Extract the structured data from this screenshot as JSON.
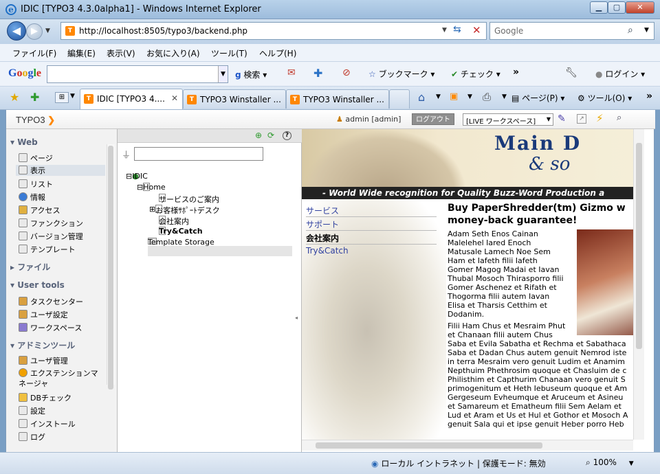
{
  "window": {
    "title": "IDIC [TYPO3 4.3.0alpha1] - Windows Internet Explorer"
  },
  "address": {
    "url": "http://localhost:8505/typo3/backend.php"
  },
  "search": {
    "placeholder": "Google"
  },
  "menu": [
    "ファイル(F)",
    "編集(E)",
    "表示(V)",
    "お気に入り(A)",
    "ツール(T)",
    "ヘルプ(H)"
  ],
  "google_toolbar": {
    "logo": "Google",
    "search": "検索",
    "bookmarks": "ブックマーク",
    "check": "チェック",
    "login": "ログイン"
  },
  "tabs": [
    {
      "label": "IDIC [TYPO3 4....",
      "active": true
    },
    {
      "label": "TYPO3 Winstaller ...",
      "active": false
    },
    {
      "label": "TYPO3 Winstaller ...",
      "active": false
    }
  ],
  "cmdbar": {
    "page": "ページ(P)",
    "tools": "ツール(O)"
  },
  "typo3": {
    "logo": "TYPO3",
    "user": "admin [admin]",
    "logout": "ログアウト",
    "workspace": "[LIVE ワークスペース]"
  },
  "modules": {
    "web": {
      "title": "Web",
      "items": [
        "ページ",
        "表示",
        "リスト",
        "情報",
        "アクセス",
        "ファンクション",
        "バージョン管理",
        "テンプレート"
      ]
    },
    "file": {
      "title": "ファイル"
    },
    "user": {
      "title": "User tools",
      "items": [
        "タスクセンター",
        "ユーザ設定",
        "ワークスペース"
      ]
    },
    "admin": {
      "title": "アドミンツール",
      "items": [
        "ユーザ管理",
        "エクステンションマネージャ",
        "DBチェック",
        "設定",
        "インストール",
        "ログ"
      ]
    }
  },
  "tree": {
    "root": "IDIC",
    "home": "Home",
    "pages": [
      "サービスのご案内",
      "お客様ｻﾎﾟｰﾄデスク",
      "会社案内",
      "Try&Catch"
    ],
    "storage": "Template Storage"
  },
  "site": {
    "banner_title": "Main D",
    "banner_sub": "& so",
    "tagline": "- World Wide recognition for Quality Buzz-Word Production a",
    "nav": [
      "サービス",
      "サポート",
      "会社案内",
      "Try&Catch"
    ],
    "heading1": "Buy PaperShredder(tm) Gizmo w",
    "heading2": "money-back guarantee!",
    "para1": [
      "Adam Seth Enos Cainan",
      "Malelehel Iared Enoch",
      "Matusale Lamech Noe Sem",
      "Ham et Iafeth filii Iafeth",
      "Gomer Magog Madai et Iavan",
      "Thubal Mosoch Thirasporro filii",
      "Gomer Aschenez et Rifath et",
      "Thogorma filii autem Iavan",
      "Elisa et Tharsis Cetthim et",
      "Dodanim."
    ],
    "para2": [
      "Filii Ham Chus et Mesraim Phut",
      "et Chanaan filii autem Chus",
      "Saba et Evila Sabatha et Rechma et Sabathaca",
      "Saba et Dadan Chus autem genuit Nemrod iste",
      "in terra Mesraim vero genuit Ludim et Anamim",
      "Nepthuim Phethrosim quoque et Chasluim de c",
      "Philisthim et Capthurim Chanaan vero genuit S",
      "primogenitum et Heth Iebuseum quoque et Am",
      "Gergeseum Evheumque et Aruceum et Asineu",
      "et Samareum et Ematheum filii Sem Aelam et",
      "Lud et Aram et Us et Hul et Gothor et Mosoch A",
      "genuit Sala qui et ipse genuit Heber porro Heb"
    ]
  },
  "status": {
    "zone": "ローカル イントラネット | 保護モード: 無効",
    "zoom": "100%"
  }
}
